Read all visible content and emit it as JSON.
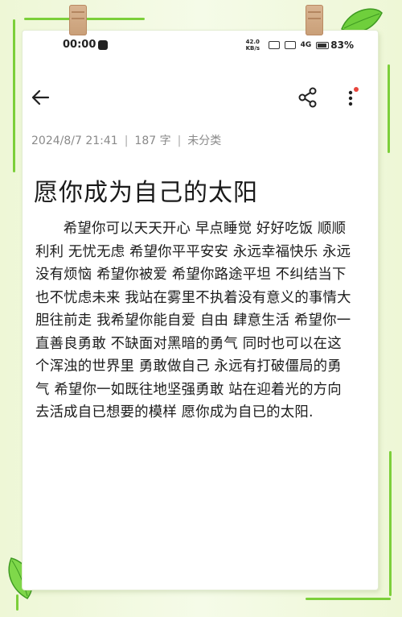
{
  "status_bar": {
    "time": "00:00",
    "network_speed": "42.0 KB/s",
    "signal": "4G",
    "battery_percent": "83%",
    "battery_level": 0.83
  },
  "toolbar": {
    "back_icon": "back-arrow-icon",
    "share_icon": "share-icon",
    "more_icon": "more-vertical-icon"
  },
  "note": {
    "date": "2024/8/7 21:41",
    "word_count": "187 字",
    "category": "未分类",
    "separator": "|",
    "title": "愿你成为自己的太阳",
    "body": "希望你可以天天开心 早点睡觉 好好吃饭 顺顺利利 无忧无虑 希望你平平安安 永远幸福快乐 永远没有烦恼 希望你被爱 希望你路途平坦 不纠结当下也不忧虑未来 我站在雾里不执着没有意义的事情大胆往前走 我希望你能自爱 自由 肆意生活 希望你一直善良勇敢 不缺面对黑暗的勇气 同时也可以在这个浑浊的世界里 勇敢做自己 永远有打破僵局的勇气 希望你一如既往地坚强勇敢 站在迎着光的方向 去活成自已想要的模样 愿你成为自已的太阳."
  },
  "colors": {
    "accent_green": "#7ccf3a",
    "notification_dot": "#e8453c",
    "background": "#f3f9e4"
  }
}
